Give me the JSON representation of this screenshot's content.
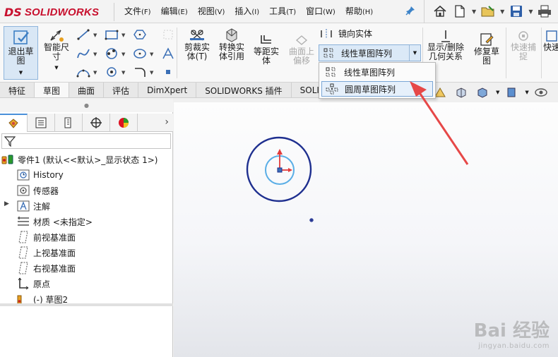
{
  "app": {
    "logo_mark": "DS",
    "logo_text": "SOLIDWORKS"
  },
  "menu": [
    {
      "label": "文件",
      "key": "(F)"
    },
    {
      "label": "编辑",
      "key": "(E)"
    },
    {
      "label": "视图",
      "key": "(V)"
    },
    {
      "label": "插入",
      "key": "(I)"
    },
    {
      "label": "工具",
      "key": "(T)"
    },
    {
      "label": "窗口",
      "key": "(W)"
    },
    {
      "label": "帮助",
      "key": "(H)"
    }
  ],
  "ribbon": {
    "exit_sketch": "退出草\n图",
    "smart_dimension": "智能尺\n寸",
    "trim_entities": "剪裁实\n体(T)",
    "convert_entities": "转换实\n体引用",
    "offset_entities": "等距实\n体",
    "offset_on_surface": "曲面上\n偏移",
    "mirror_entities": "镜向实体",
    "linear_pattern": "线性草图阵列",
    "display_relations": "显示/删除\n几何关系",
    "repair_sketch": "修复草\n图",
    "quick_snaps": "快速捕\n捉",
    "rapid_sketch": "快速"
  },
  "tabs": [
    "特征",
    "草图",
    "曲面",
    "评估",
    "DimXpert",
    "SOLIDWORKS 插件",
    "SOLIDW"
  ],
  "dropdown": {
    "items": [
      "线性草图阵列",
      "圆周草图阵列"
    ],
    "highlighted": 1
  },
  "tree": {
    "root": "零件1  (默认<<默认>_显示状态 1>)",
    "items": [
      {
        "label": "History",
        "icon": "history-icon"
      },
      {
        "label": "传感器",
        "icon": "sensor-icon"
      },
      {
        "label": "注解",
        "icon": "annotation-icon"
      },
      {
        "label": "材质 <未指定>",
        "icon": "material-icon"
      },
      {
        "label": "前视基准面",
        "icon": "plane-icon"
      },
      {
        "label": "上视基准面",
        "icon": "plane-icon"
      },
      {
        "label": "右视基准面",
        "icon": "plane-icon"
      },
      {
        "label": "原点",
        "icon": "origin-icon"
      },
      {
        "label": "(-) 草图2",
        "icon": "sketch-icon"
      }
    ]
  },
  "watermark": {
    "brand": "Bai 经验",
    "url": "jingyan.baidu.com"
  },
  "colors": {
    "accent": "#3c83c8",
    "arrow": "#e64848",
    "circle_outer": "#1e2f8f",
    "circle_inner": "#5aaee6",
    "brand_red": "#c8102e"
  }
}
